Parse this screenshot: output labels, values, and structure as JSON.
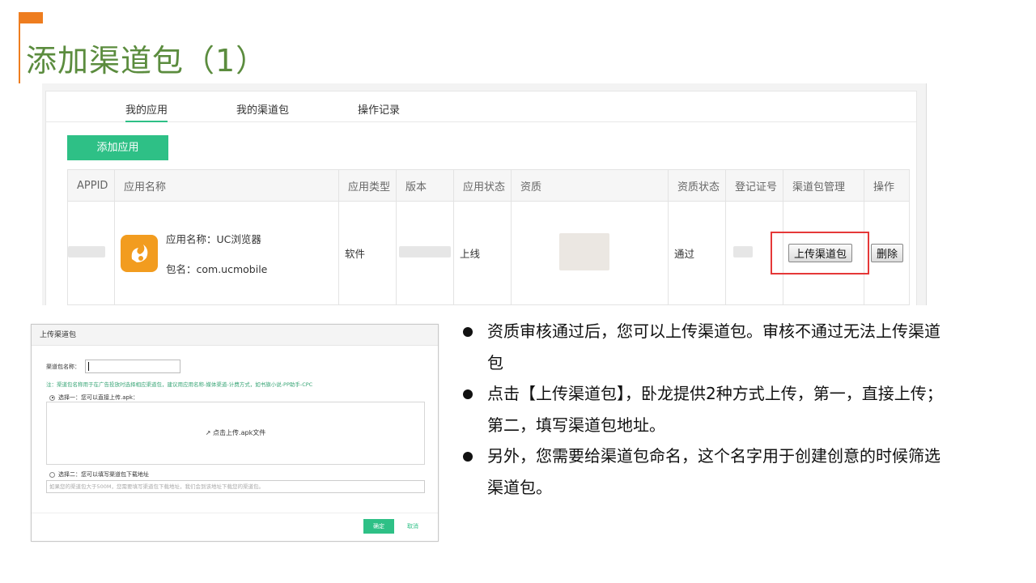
{
  "slide": {
    "title": "添加渠道包（1）"
  },
  "tabs": [
    {
      "label": "我的应用",
      "active": true
    },
    {
      "label": "我的渠道包",
      "active": false
    },
    {
      "label": "操作记录",
      "active": false
    }
  ],
  "add_app_button": "添加应用",
  "table": {
    "headers": [
      "APPID",
      "应用名称",
      "应用类型",
      "版本",
      "应用状态",
      "资质",
      "资质状态",
      "登记证号",
      "渠道包管理",
      "操作"
    ],
    "row": {
      "app_name_line": "应用名称：UC浏览器",
      "package_line": "包名：com.ucmobile",
      "app_type": "软件",
      "status": "上线",
      "qual_status": "通过",
      "upload_button": "上传渠道包",
      "delete_button": "删除"
    }
  },
  "dialog": {
    "title": "上传渠道包",
    "name_label": "渠道包名称：",
    "note": "注：渠道包名称用于在广告投放时选择相应渠道包，建议用应用名称-媒体渠道-计费方式，如书旗小说-PP助手-CPC",
    "option1": "选择一：您可以直接上传.apk：",
    "upload_text": "点击上传.apk文件",
    "option2": "选择二：您可以填写渠道包下载地址",
    "url_placeholder": "如果您的渠道包大于500M，您需要填写渠道包下载地址，我们会到该地址下载您的渠道包。",
    "ok": "确定",
    "cancel": "取消"
  },
  "bullets": [
    "资质审核通过后，您可以上传渠道包。审核不通过无法上传渠道包",
    "点击【上传渠道包】，卧龙提供2种方式上传，第一，直接上传；第二，填写渠道包地址。",
    "另外，您需要给渠道包命名，这个名字用于创建创意的时候筛选渠道包。"
  ],
  "colors": {
    "title_green": "#5b8c3e",
    "accent_orange": "#ee7d1f",
    "brand_green": "#2ec086",
    "highlight_red": "#e53838"
  }
}
